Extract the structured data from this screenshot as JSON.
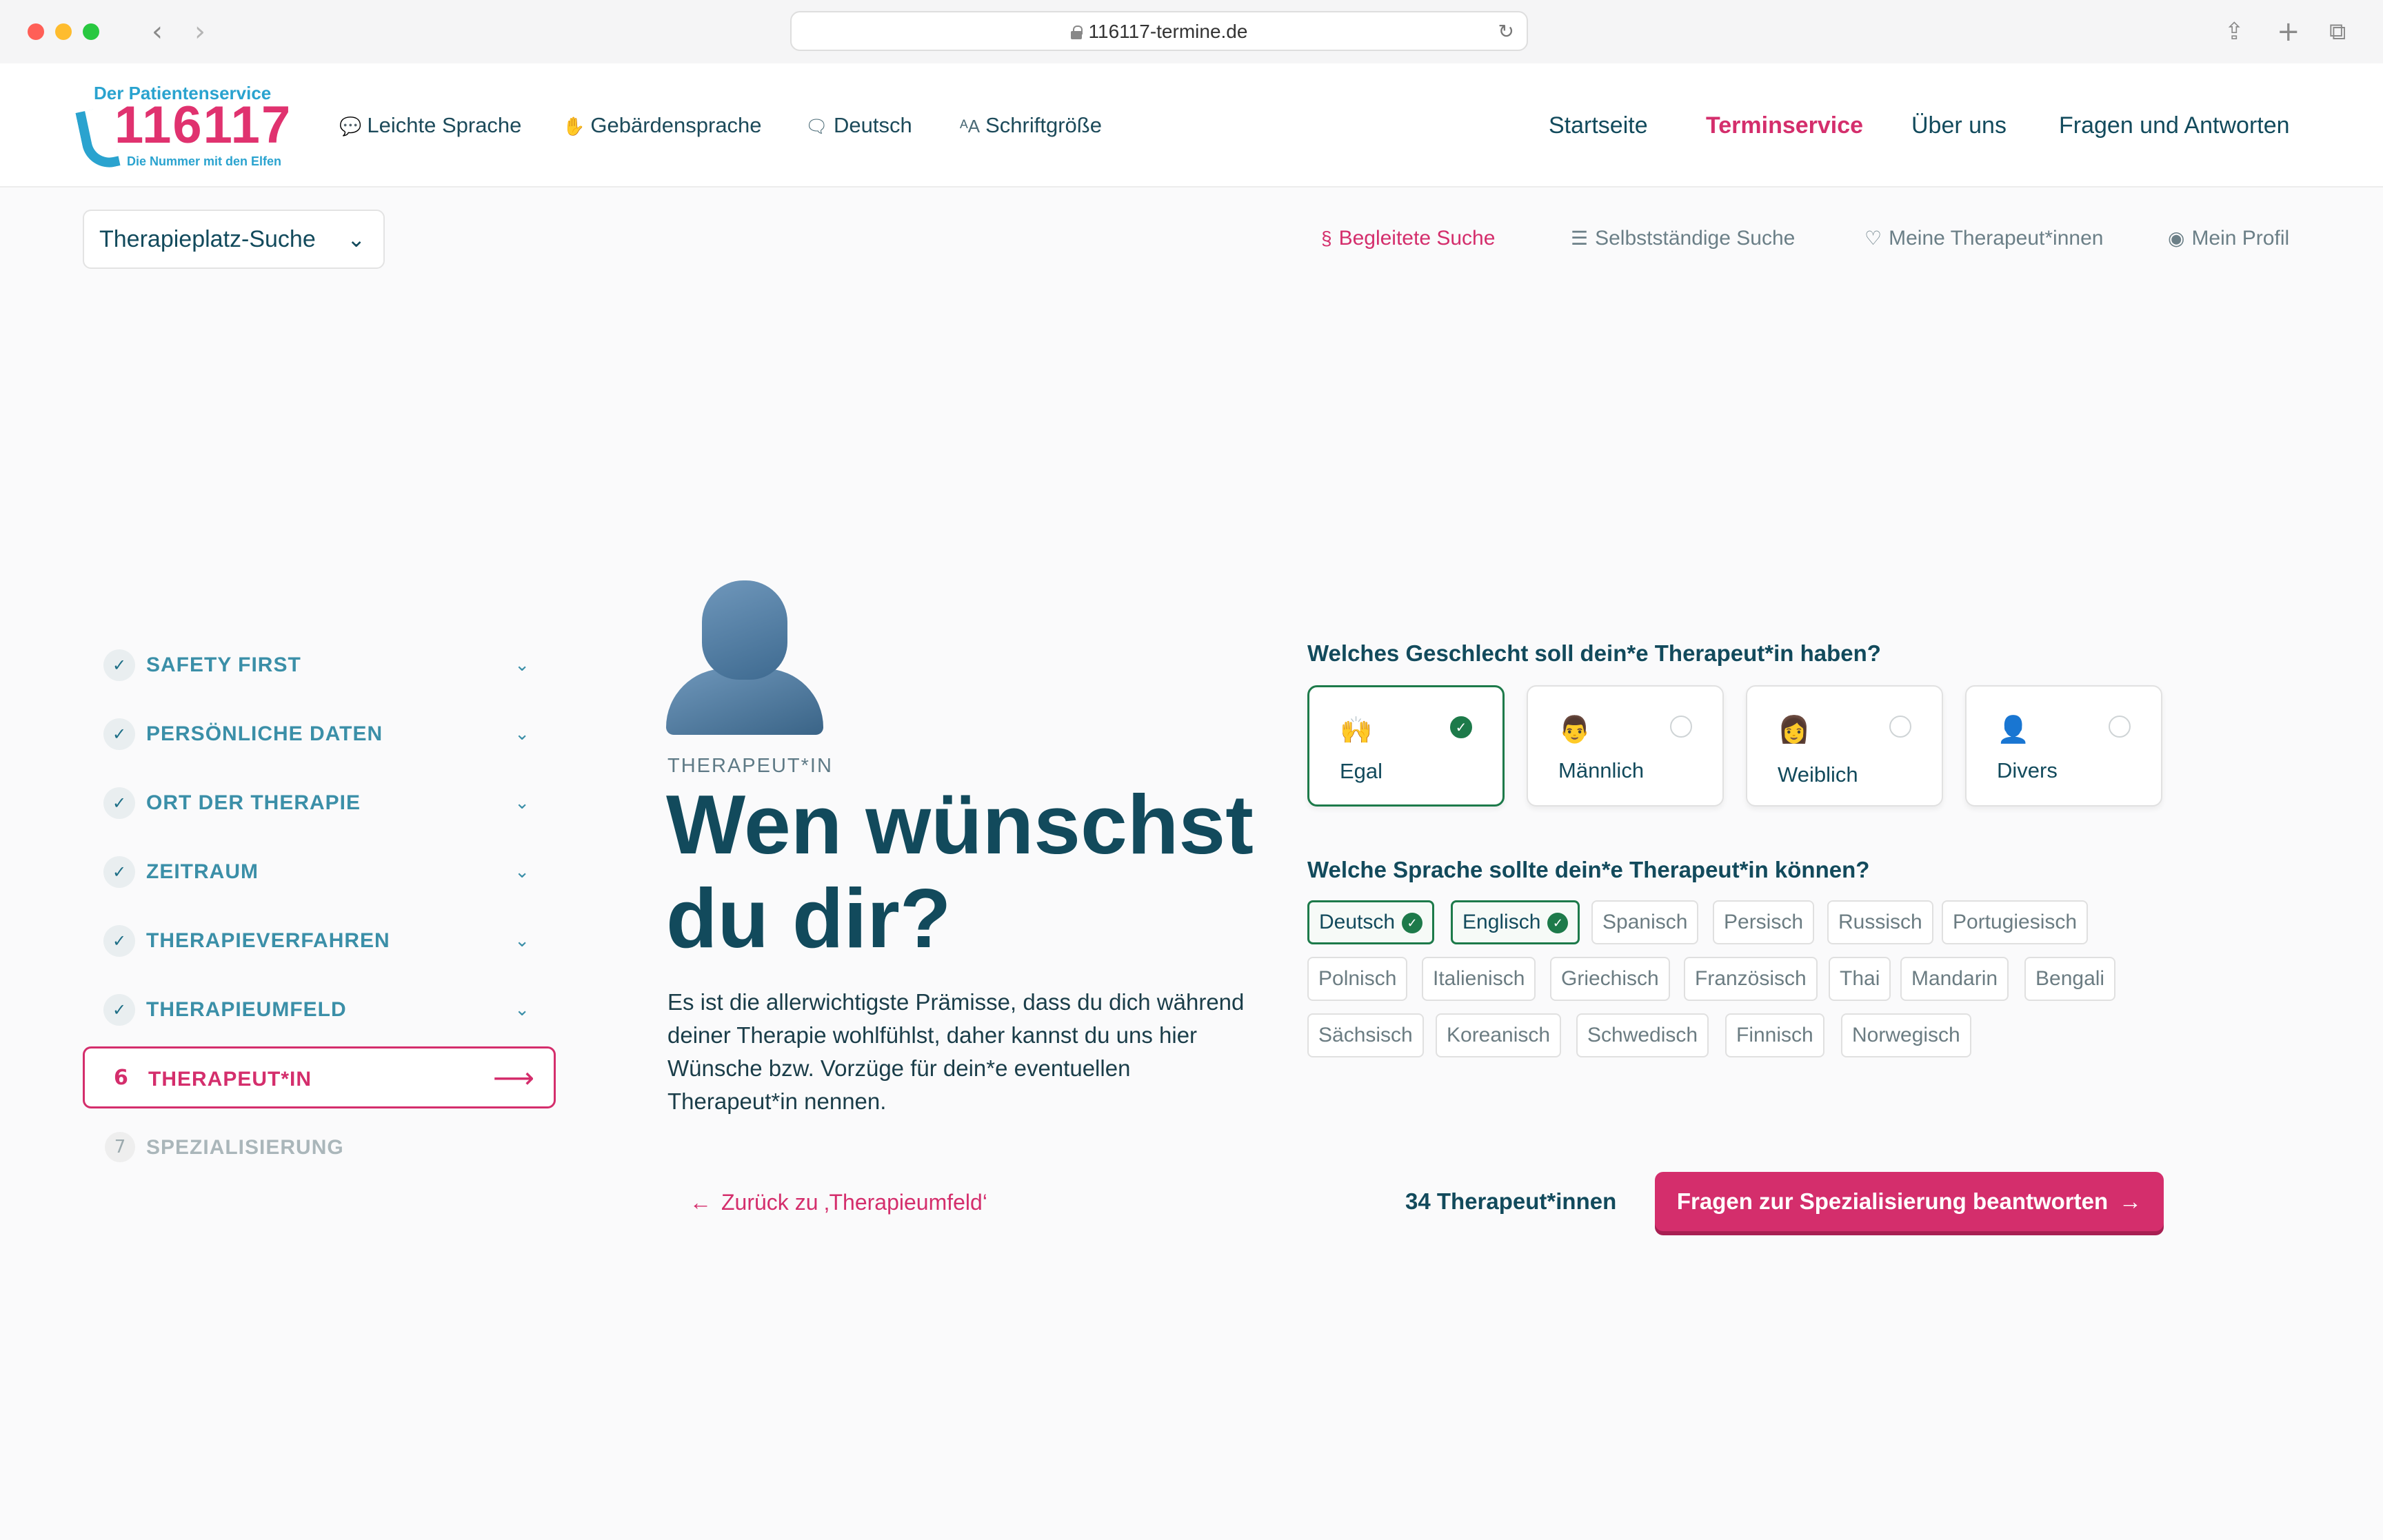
{
  "browser": {
    "url": "116117-termine.de",
    "back_icon": "‹",
    "forward_icon": "›",
    "share_icon": "⇪",
    "new_tab_icon": "+",
    "tabs_icon": "⧉",
    "reload_icon": "↻",
    "traffic_colors": [
      "#ff5f57",
      "#febc2e",
      "#28c840"
    ]
  },
  "logo": {
    "top": "Der Patientenservice",
    "number": "116117",
    "sub": "Die Nummer mit den Elfen"
  },
  "utility_nav": [
    {
      "icon": "speech-bubble-icon",
      "glyph": "💬",
      "label": "Leichte Sprache"
    },
    {
      "icon": "hand-icon",
      "glyph": "✋",
      "label": "Gebärdensprache"
    },
    {
      "icon": "chat-icon",
      "glyph": "🗨",
      "label": "Deutsch"
    },
    {
      "icon": "font-size-icon",
      "glyph": "ᴬA",
      "label": "Schriftgröße"
    }
  ],
  "main_nav": [
    {
      "label": "Startseite",
      "active": false
    },
    {
      "label": "Terminservice",
      "active": true
    },
    {
      "label": "Über uns",
      "active": false
    },
    {
      "label": "Fragen und Antworten",
      "active": false
    }
  ],
  "search_dropdown": {
    "label": "Therapieplatz-Suche",
    "chevron": "⌄"
  },
  "sub_nav": [
    {
      "icon": "route-icon",
      "glyph": "§",
      "label": "Begleitete Suche",
      "active": true
    },
    {
      "icon": "sliders-icon",
      "glyph": "☰",
      "label": "Selbstständige Suche",
      "active": false
    },
    {
      "icon": "heart-icon",
      "glyph": "♡",
      "label": "Meine Therapeut*innen",
      "active": false
    },
    {
      "icon": "user-circle-icon",
      "glyph": "◉",
      "label": "Mein Profil",
      "active": false
    }
  ],
  "steps": {
    "done": [
      {
        "label": "SAFETY FIRST"
      },
      {
        "label": "PERSÖNLICHE DATEN"
      },
      {
        "label": "ORT DER THERAPIE"
      },
      {
        "label": "ZEITRAUM"
      },
      {
        "label": "THERAPIEVERFAHREN"
      },
      {
        "label": "THERAPIEUMFELD"
      }
    ],
    "current": {
      "number": "6",
      "label": "THERAPEUT*IN",
      "arrow": "⟶"
    },
    "next": {
      "number": "7",
      "label": "SPEZIALISIERUNG"
    },
    "check_glyph": "✓",
    "chevron_glyph": "⌄"
  },
  "content": {
    "eyebrow": "THERAPEUT*IN",
    "headline": "Wen wünschst du dir?",
    "intro": "Es ist die allerwichtigste Prämisse, dass du dich während deiner Therapie wohlfühlst, daher kannst du uns hier Wünsche bzw. Vorzüge für dein*e eventuellen Therapeut*in nennen.",
    "back_link": "Zurück zu ‚Therapieumfeld‘",
    "back_arrow": "←"
  },
  "gender_question": {
    "title": "Welches Geschlecht soll dein*e Therapeut*in haben?",
    "options": [
      {
        "label": "Egal",
        "emoji": "🙌",
        "selected": true
      },
      {
        "label": "Männlich",
        "emoji": "👨",
        "selected": false
      },
      {
        "label": "Weiblich",
        "emoji": "👩",
        "selected": false
      },
      {
        "label": "Divers",
        "emoji": "👤",
        "selected": false
      }
    ]
  },
  "language_question": {
    "title": "Welche Sprache sollte dein*e Therapeut*in können?",
    "rows": [
      [
        {
          "label": "Deutsch",
          "selected": true
        },
        {
          "label": "Englisch",
          "selected": true
        },
        {
          "label": "Spanisch",
          "selected": false
        },
        {
          "label": "Persisch",
          "selected": false
        },
        {
          "label": "Russisch",
          "selected": false
        },
        {
          "label": "Portugiesisch",
          "selected": false
        }
      ],
      [
        {
          "label": "Polnisch",
          "selected": false
        },
        {
          "label": "Italienisch",
          "selected": false
        },
        {
          "label": "Griechisch",
          "selected": false
        },
        {
          "label": "Französisch",
          "selected": false
        },
        {
          "label": "Thai",
          "selected": false
        },
        {
          "label": "Mandarin",
          "selected": false
        },
        {
          "label": "Bengali",
          "selected": false
        }
      ],
      [
        {
          "label": "Sächsisch",
          "selected": false
        },
        {
          "label": "Koreanisch",
          "selected": false
        },
        {
          "label": "Schwedisch",
          "selected": false
        },
        {
          "label": "Finnisch",
          "selected": false
        },
        {
          "label": "Norwegisch",
          "selected": false
        }
      ]
    ]
  },
  "footer_actions": {
    "count": "34 Therapeut*innen",
    "cta": "Fragen zur Spezialisierung beantworten",
    "cta_arrow": "→"
  },
  "colors": {
    "brand_pink": "#d42e6c",
    "brand_teal": "#124a5c",
    "accent_green": "#1d7a4a",
    "logo_blue": "#2aa3cf"
  }
}
